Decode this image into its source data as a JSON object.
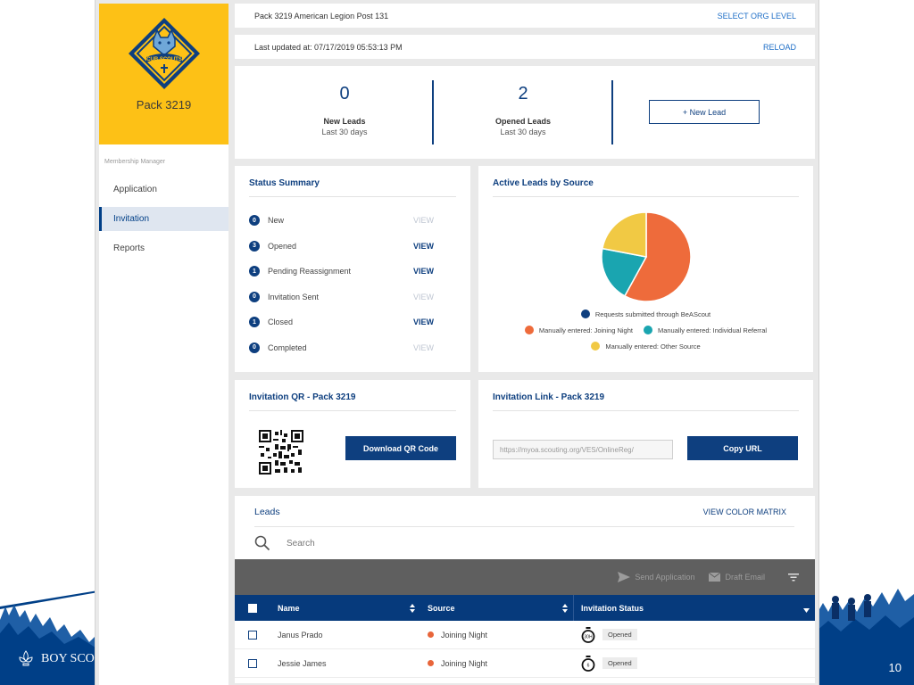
{
  "slide": {
    "page_number": "10",
    "footer_logo_text": "BOY SCO"
  },
  "sidebar": {
    "brand_name": "Pack 3219",
    "logo_text": "CUB SCOUTS",
    "caption": "Membership Manager",
    "items": [
      {
        "label": "Application",
        "active": false
      },
      {
        "label": "Invitation",
        "active": true
      },
      {
        "label": "Reports",
        "active": false
      }
    ]
  },
  "org_bar": {
    "title": "Pack 3219 American Legion Post 131",
    "action": "SELECT ORG LEVEL"
  },
  "update_bar": {
    "text": "Last updated at: 07/17/2019 05:53:13 PM",
    "action": "RELOAD"
  },
  "stats": {
    "new_leads": {
      "value": "0",
      "label": "New Leads",
      "sub": "Last 30 days"
    },
    "opened_leads": {
      "value": "2",
      "label": "Opened Leads",
      "sub": "Last 30 days"
    },
    "new_lead_button": "+ New Lead"
  },
  "status_summary": {
    "title": "Status Summary",
    "rows": [
      {
        "count": "0",
        "label": "New",
        "action": "VIEW",
        "enabled": false
      },
      {
        "count": "3",
        "label": "Opened",
        "action": "VIEW",
        "enabled": true
      },
      {
        "count": "1",
        "label": "Pending Reassignment",
        "action": "VIEW",
        "enabled": true
      },
      {
        "count": "0",
        "label": "Invitation Sent",
        "action": "VIEW",
        "enabled": false
      },
      {
        "count": "1",
        "label": "Closed",
        "action": "VIEW",
        "enabled": true
      },
      {
        "count": "0",
        "label": "Completed",
        "action": "VIEW",
        "enabled": false
      }
    ]
  },
  "active_leads": {
    "title": "Active Leads by Source",
    "legend": [
      {
        "label": "Requests submitted through BeAScout",
        "color": "#0e3f7f"
      },
      {
        "label": "Manually entered: Joining Night",
        "color": "#ee6b3b"
      },
      {
        "label": "Manually entered: Individual Referral",
        "color": "#1aa5b0"
      },
      {
        "label": "Manually entered: Other Source",
        "color": "#f1c944"
      }
    ]
  },
  "chart_data": {
    "type": "pie",
    "title": "Active Leads by Source",
    "categories": [
      "Requests submitted through BeAScout",
      "Manually entered: Joining Night",
      "Manually entered: Individual Referral",
      "Manually entered: Other Source"
    ],
    "values": [
      0,
      58,
      20,
      22
    ],
    "colors": [
      "#0e3f7f",
      "#ee6b3b",
      "#1aa5b0",
      "#f1c944"
    ],
    "legend_position": "bottom"
  },
  "qr_card": {
    "title": "Invitation QR - Pack 3219",
    "button": "Download QR Code"
  },
  "link_card": {
    "title": "Invitation Link - Pack 3219",
    "url_value": "https://myoa.scouting.org/VES/OnlineReg/",
    "button": "Copy URL"
  },
  "leads": {
    "title": "Leads",
    "action": "VIEW COLOR MATRIX",
    "search_placeholder": "Search",
    "toolbar": {
      "send": "Send Application",
      "draft": "Draft Email"
    },
    "columns": [
      "Name",
      "Source",
      "Invitation Status"
    ],
    "rows": [
      {
        "name": "Janus Prado",
        "source": "Joining Night",
        "timer": "30H",
        "status": "Opened"
      },
      {
        "name": "Jessie James",
        "source": "Joining Night",
        "timer": "6",
        "status": "Opened"
      }
    ]
  }
}
